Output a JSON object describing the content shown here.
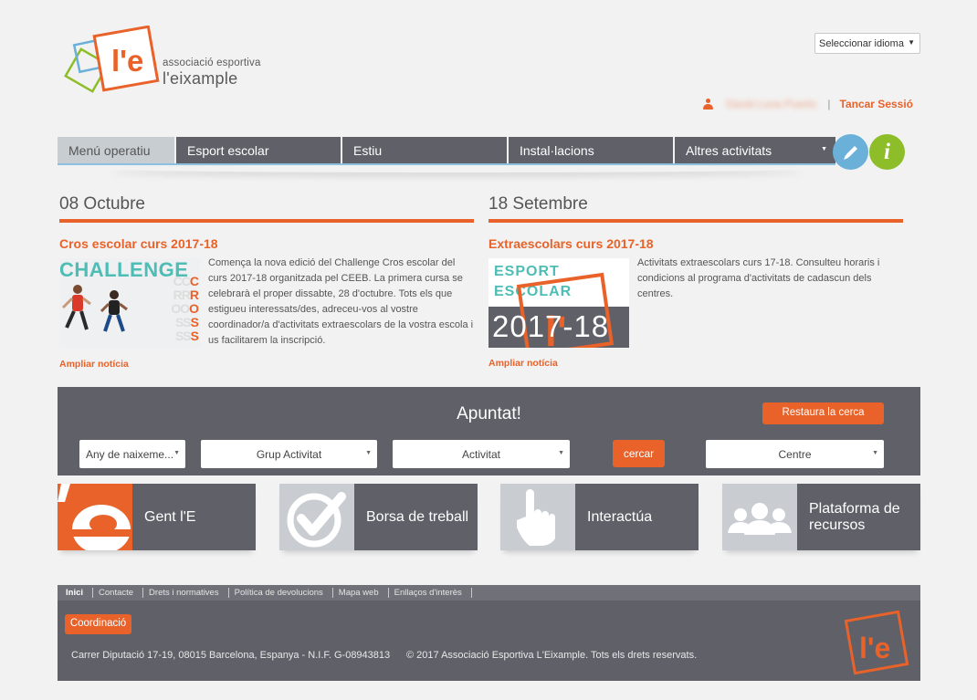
{
  "header": {
    "logo_mark": "l'e",
    "logo_line1": "associació esportiva",
    "logo_line2": "l'eixample",
    "language_select": "Seleccionar idioma",
    "user_name": "David Luna Puerto",
    "logout": "Tancar Sessió"
  },
  "nav": {
    "items": [
      {
        "label": "Menú operatiu"
      },
      {
        "label": "Esport escolar"
      },
      {
        "label": "Estiu"
      },
      {
        "label": "Instal·lacions"
      },
      {
        "label": "Altres activitats"
      }
    ],
    "edit_icon": "pencil-icon",
    "info_label": "i"
  },
  "news": [
    {
      "date": "08 Octubre",
      "title": "Cros escolar curs 2017-18",
      "body": "Comença la nova edició del Challenge Cros escolar del curs 2017-18 organitzada pel CEEB. La primera cursa se celebrarà el proper dissabte, 28 d'octubre. Tots els que estigueu interessats/des, adreceu-vos al vostre coordinador/a d'activitats extraescolars de la vostra escola i us facilitarem la inscripció.",
      "more": "Ampliar notícia",
      "image_text": "CHALLENGE"
    },
    {
      "date": "18 Setembre",
      "title": "Extraescolars curs 2017-18",
      "body": "Activitats extraescolars curs 17-18. Consulteu horaris i condicions al programa d'activitats de cadascun dels centres.",
      "more": "Ampliar notícia",
      "image_text1": "ESPORT",
      "image_text2": "ESCOLAR",
      "image_text3": "2017-18"
    }
  ],
  "search": {
    "title": "Apuntat!",
    "reset": "Restaura la cerca",
    "birth_year": "Any de naixeme...",
    "group": "Grup Activitat",
    "activity": "Activitat",
    "go": "cercar",
    "center": "Centre"
  },
  "tiles": [
    {
      "label": "Gent l'E",
      "icon": "le-logo-icon"
    },
    {
      "label": "Borsa de treball",
      "icon": "checkmark-icon"
    },
    {
      "label": "Interactúa",
      "icon": "hand-pointer-icon"
    },
    {
      "label": "Plataforma de recursos",
      "icon": "people-icon"
    }
  ],
  "footer": {
    "links": [
      "Inici",
      "Contacte",
      "Drets i normatives",
      "Política de devolucions",
      "Mapa web",
      "Enllaços d'interès"
    ],
    "coord": "Coordinació",
    "address": "Carrer Diputació 17-19, 08015 Barcelona, Espanya - N.I.F. G-08943813",
    "copyright": "© 2017 Associació Esportiva L'Eixample. Tots els drets reservats."
  },
  "colors": {
    "accent": "#e8622a",
    "dark": "#5f6068",
    "info_green": "#8dbd28",
    "edit_blue": "#6bb0d8",
    "teal": "#4dbdb5"
  }
}
